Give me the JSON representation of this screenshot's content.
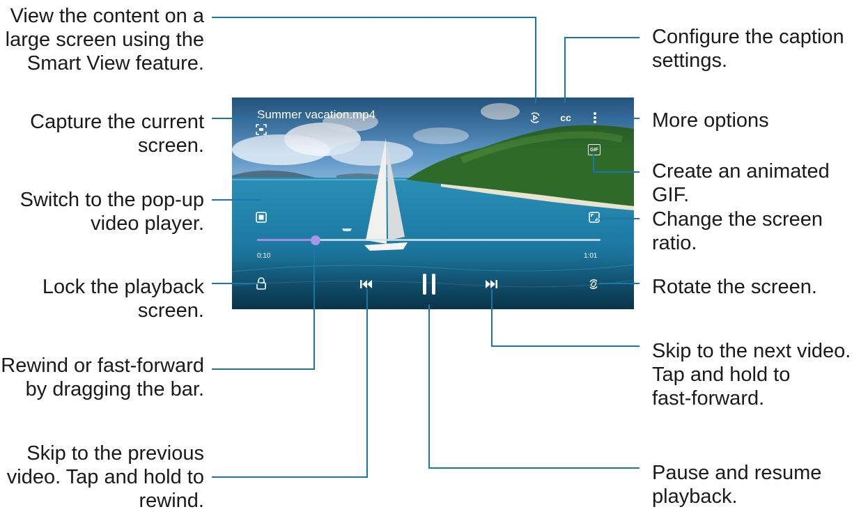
{
  "player": {
    "file_title": "Summer vacation.mp4",
    "elapsed": "0:10",
    "duration": "1:01",
    "progress_fraction": 0.17,
    "gif_label": "GIF",
    "cc_label": "cc"
  },
  "callouts": {
    "smart_view": "View the content on a\nlarge screen using the\nSmart View feature.",
    "capture": "Capture the current\nscreen.",
    "popup": "Switch to the pop-up\nvideo player.",
    "lock": "Lock the playback\nscreen.",
    "seek": "Rewind or fast-forward\nby dragging the bar.",
    "previous": "Skip to the previous\nvideo. Tap and hold to\nrewind.",
    "captions": "Configure the caption\nsettings.",
    "more": "More options",
    "gif": "Create an animated GIF.",
    "ratio": "Change the screen ratio.",
    "rotate": "Rotate the screen.",
    "next": "Skip to the next video.\nTap and hold to\nfast-forward.",
    "pause": "Pause and resume\nplayback."
  },
  "icons": {
    "smart_view": "smart-view-icon",
    "captions": "cc-icon",
    "more": "more-vertical-icon",
    "capture": "capture-icon",
    "gif": "gif-icon",
    "popup": "popup-player-icon",
    "ratio": "screen-ratio-icon",
    "lock": "lock-icon",
    "previous": "previous-icon",
    "pause": "pause-icon",
    "next": "next-icon",
    "rotate": "rotate-icon"
  },
  "colors": {
    "leader_line": "#1b75a6",
    "text": "#1a1a1a",
    "progress_played": "#a08ce0",
    "progress_track": "#d9e2e8"
  }
}
